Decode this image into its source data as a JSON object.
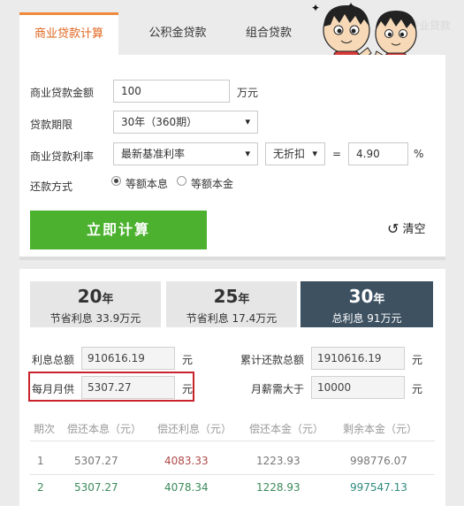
{
  "tabs": [
    {
      "label": "商业贷款计算",
      "active": true
    },
    {
      "label": "公积金贷款",
      "active": false
    },
    {
      "label": "组合贷款",
      "active": false
    }
  ],
  "watermark": "专业贷款",
  "form": {
    "amount": {
      "label": "商业贷款金额",
      "value": "100",
      "unit": "万元"
    },
    "term": {
      "label": "贷款期限",
      "value": "30年（360期）"
    },
    "rate": {
      "label": "商业贷款利率",
      "basis": "最新基准利率",
      "discount": "无折扣",
      "equals": "=",
      "value": "4.90",
      "unit": "%"
    },
    "method": {
      "label": "还款方式",
      "options": [
        "等额本息",
        "等额本金"
      ],
      "selected": 0
    },
    "calc_button": "立即计算",
    "clear_button": "清空"
  },
  "result": {
    "years": [
      {
        "year": "20",
        "unit": "年",
        "desc": "节省利息 33.9万元"
      },
      {
        "year": "25",
        "unit": "年",
        "desc": "节省利息 17.4万元"
      },
      {
        "year": "30",
        "unit": "年",
        "desc": "总利息 91万元",
        "active": true
      }
    ],
    "total_interest": {
      "label": "利息总额",
      "value": "910616.19",
      "unit": "元"
    },
    "total_repay": {
      "label": "累计还款总额",
      "value": "1910616.19",
      "unit": "元"
    },
    "monthly": {
      "label": "每月月供",
      "value": "5307.27",
      "unit": "元"
    },
    "salary": {
      "label": "月薪需大于",
      "value": "10000",
      "unit": "元"
    },
    "table": {
      "headers": [
        "期次",
        "偿还本息（元）",
        "偿还利息（元）",
        "偿还本金（元）",
        "剩余本金（元）"
      ],
      "rows": [
        [
          "1",
          "5307.27",
          "4083.33",
          "1223.93",
          "998776.07"
        ],
        [
          "2",
          "5307.27",
          "4078.34",
          "1228.93",
          "997547.13"
        ]
      ]
    }
  },
  "colors": {
    "accent": "#f08a3c",
    "calc_green": "#4bb12e",
    "dark_tab": "#3d5161",
    "highlight_red": "#c8232c"
  }
}
